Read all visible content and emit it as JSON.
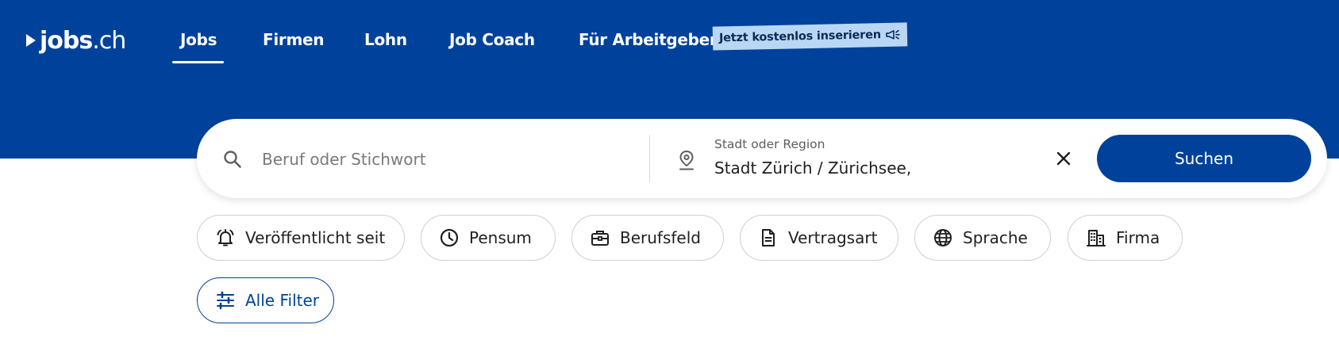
{
  "brand": {
    "logo_text_bold": "jobs",
    "logo_text_light": ".ch"
  },
  "nav": {
    "items": [
      {
        "label": "Jobs",
        "active": true
      },
      {
        "label": "Firmen"
      },
      {
        "label": "Lohn"
      },
      {
        "label": "Job Coach"
      },
      {
        "label": "Für Arbeitgeber"
      }
    ],
    "promo_label": "Jetzt kostenlos inserieren"
  },
  "search": {
    "keyword_placeholder": "Beruf oder Stichwort",
    "keyword_value": "",
    "location_label": "Stadt oder Region",
    "location_value": "Stadt Zürich / Zürichsee,",
    "submit_label": "Suchen"
  },
  "filters": [
    {
      "label": "Veröffentlicht seit",
      "icon": "bell-icon"
    },
    {
      "label": "Pensum",
      "icon": "clock-icon"
    },
    {
      "label": "Berufsfeld",
      "icon": "briefcase-icon"
    },
    {
      "label": "Vertragsart",
      "icon": "document-icon"
    },
    {
      "label": "Sprache",
      "icon": "globe-icon"
    },
    {
      "label": "Firma",
      "icon": "building-icon"
    }
  ],
  "all_filters_label": "Alle Filter",
  "colors": {
    "primary": "#00429b",
    "promo_bg": "#b9d7f5",
    "white": "#ffffff"
  }
}
